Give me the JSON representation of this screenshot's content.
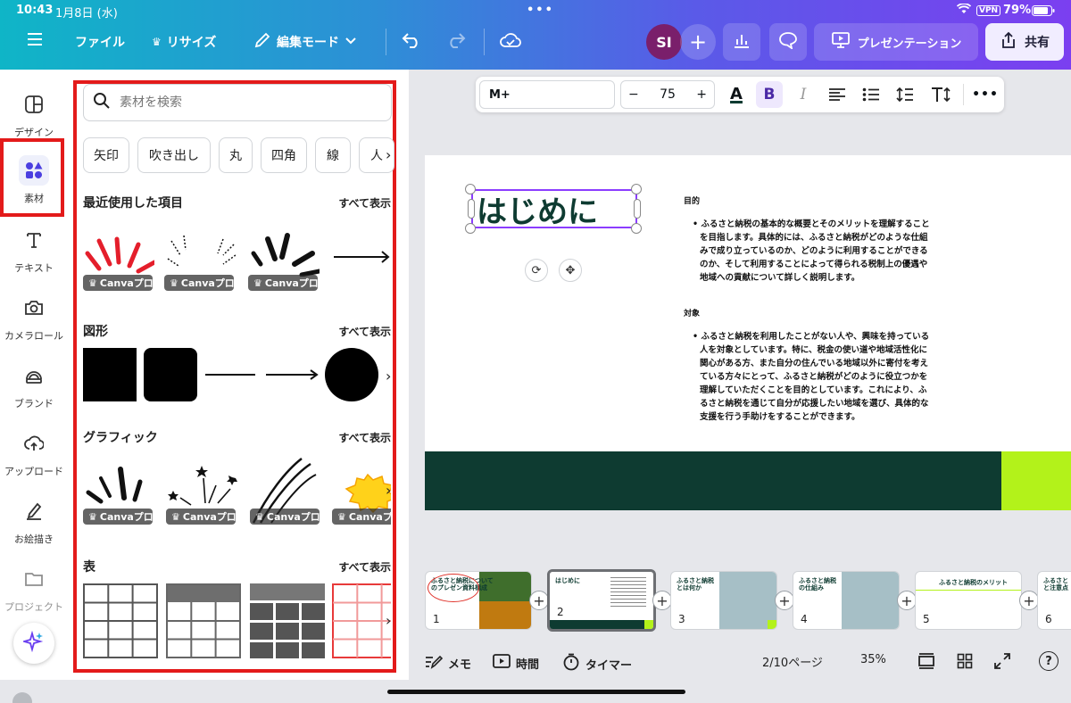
{
  "status": {
    "time": "10:43",
    "date": "1月8日 (水)",
    "vpn": "VPN",
    "battery": "79%"
  },
  "topbar": {
    "file": "ファイル",
    "resize": "リサイズ",
    "edit_mode": "編集モード",
    "avatar": "SI",
    "present": "プレゼンテーション",
    "share": "共有"
  },
  "rail": [
    {
      "label": "デザイン",
      "icon": "layout-icon"
    },
    {
      "label": "素材",
      "icon": "shapes-icon"
    },
    {
      "label": "テキスト",
      "icon": "text-icon"
    },
    {
      "label": "カメラロール",
      "icon": "camera-icon"
    },
    {
      "label": "ブランド",
      "icon": "brand-icon"
    },
    {
      "label": "アップロード",
      "icon": "upload-icon"
    },
    {
      "label": "お絵描き",
      "icon": "draw-icon"
    },
    {
      "label": "プロジェクト",
      "icon": "folder-icon"
    }
  ],
  "panel": {
    "search_placeholder": "素材を検索",
    "chips": [
      "矢印",
      "吹き出し",
      "丸",
      "四角",
      "線",
      "人"
    ],
    "sections": [
      {
        "title": "最近使用した項目",
        "link": "すべて表示"
      },
      {
        "title": "図形",
        "link": "すべて表示"
      },
      {
        "title": "グラフィック",
        "link": "すべて表示"
      },
      {
        "title": "表",
        "link": "すべて表示"
      }
    ],
    "badge": "Canvaプロ"
  },
  "toolbar": {
    "font": "M+",
    "size": "75",
    "bold": "B",
    "italic": "I"
  },
  "slide": {
    "heading": "はじめに",
    "goal_title": "目的",
    "goal_text": "ふるさと納税の基本的な概要とそのメリットを理解することを目指します。具体的には、ふるさと納税がどのような仕組みで成り立っているのか、どのように利用することができるのか、そして利用することによって得られる税制上の優遇や地域への貢献について詳しく説明します。",
    "target_title": "対象",
    "target_text": "ふるさと納税を利用したことがない人や、興味を持っている人を対象としています。特に、税金の使い道や地域活性化に関心がある方、また自分の住んでいる地域以外に寄付を考えている方々にとって、ふるさと納税がどのように役立つかを理解していただくことを目的としています。これにより、ふるさと納税を通じて自分が応援したい地域を選び、具体的な支援を行う手助けをすることができます。"
  },
  "pages": [
    {
      "num": "1",
      "title": "ふるさと納税について\nのプレゼン資料構成"
    },
    {
      "num": "2",
      "title": "はじめに"
    },
    {
      "num": "3",
      "title": "ふるさと納税\nとは何か"
    },
    {
      "num": "4",
      "title": "ふるさと納税\nの仕組み"
    },
    {
      "num": "5",
      "title": "ふるさと納税のメリット"
    },
    {
      "num": "6",
      "title": "ふるさと\nと注意点"
    }
  ],
  "bottombar": {
    "memo": "メモ",
    "time": "時間",
    "timer": "タイマー",
    "page": "2/10ページ",
    "zoom": "35%",
    "help": "?"
  }
}
